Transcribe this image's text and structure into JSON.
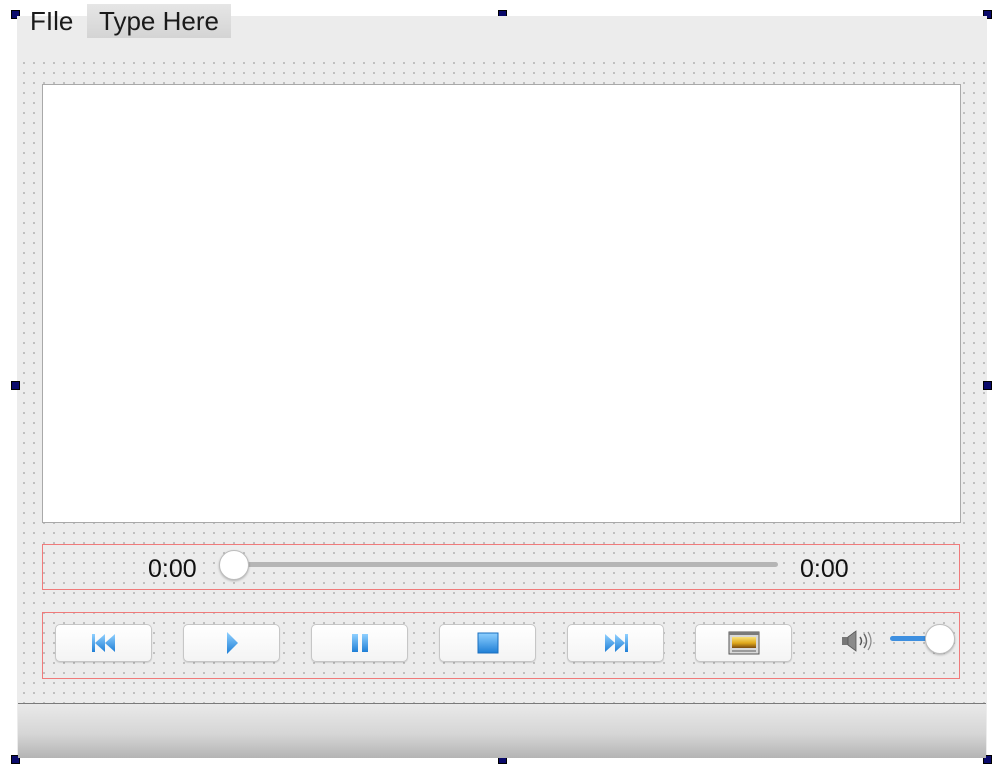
{
  "menubar": {
    "items": [
      {
        "label": "FIle"
      },
      {
        "label": "Type Here"
      }
    ]
  },
  "seek": {
    "current_time": "0:00",
    "total_time": "0:00",
    "position": 0
  },
  "controls": {
    "buttons": [
      {
        "icon": "skip-back-icon"
      },
      {
        "icon": "play-icon"
      },
      {
        "icon": "pause-icon"
      },
      {
        "icon": "stop-icon"
      },
      {
        "icon": "skip-forward-icon"
      },
      {
        "icon": "fullscreen-image-icon"
      }
    ],
    "volume_icon": "speaker-icon",
    "volume_level": 1.0
  },
  "colors": {
    "accent": "#3d8fe0",
    "layout_border": "#f07a7a",
    "handle": "#0a0a6b"
  }
}
